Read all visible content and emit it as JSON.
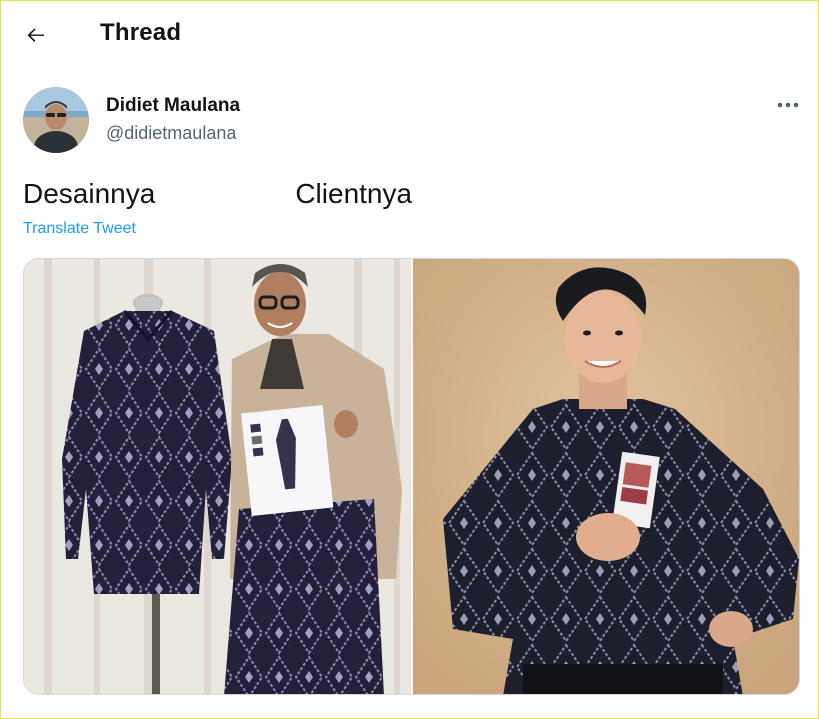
{
  "header": {
    "back_icon": "arrow-left-icon",
    "title": "Thread"
  },
  "tweet": {
    "author_name": "Didiet Maulana",
    "author_handle": "@didietmaulana",
    "more_icon": "more-horizontal-icon",
    "text": "Desainnya                  Clientnya",
    "translate_label": "Translate Tweet"
  },
  "colors": {
    "link": "#1d9bf0",
    "secondary_text": "#536471",
    "primary_text": "#0f1419",
    "border": "#cfd9de"
  }
}
